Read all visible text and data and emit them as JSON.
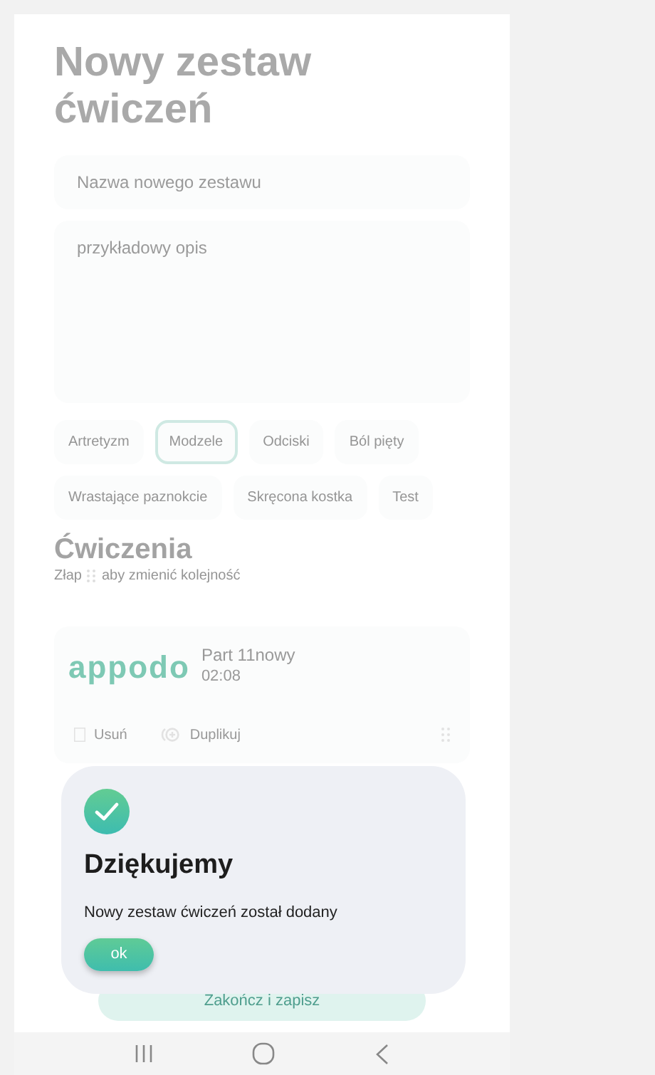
{
  "page": {
    "title": "Nowy zestaw ćwiczeń"
  },
  "form": {
    "name_placeholder": "Nazwa nowego zestawu",
    "description_placeholder": "przykładowy opis"
  },
  "tags": [
    {
      "label": "Artretyzm",
      "selected": false
    },
    {
      "label": "Modzele",
      "selected": true
    },
    {
      "label": "Odciski",
      "selected": false
    },
    {
      "label": "Ból pięty",
      "selected": false
    },
    {
      "label": "Wrastające paznokcie",
      "selected": false
    },
    {
      "label": "Skręcona kostka",
      "selected": false
    },
    {
      "label": "Test",
      "selected": false
    }
  ],
  "exercises_section": {
    "title": "Ćwiczenia",
    "hint_before": "Złap",
    "hint_after": "aby zmienić kolejność"
  },
  "exercises": [
    {
      "logo": "appodo",
      "name": "Part 11nowy",
      "duration": "02:08",
      "delete_label": "Usuń",
      "duplicate_label": "Duplikuj"
    }
  ],
  "finish_button": "Zakończ i zapisz",
  "dialog": {
    "title": "Dziękujemy",
    "message": "Nowy zestaw ćwiczeń został dodany",
    "button": "ok"
  }
}
